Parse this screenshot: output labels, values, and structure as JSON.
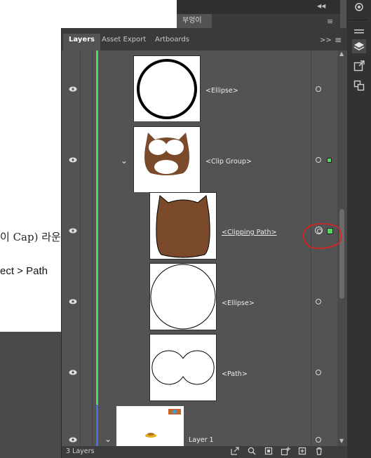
{
  "document": {
    "line1": "이 Cap) 라운",
    "line2": "ect > Path"
  },
  "mini_panel": {
    "tab": "부엉이",
    "collapse_icon": "double-chevron-right",
    "menu_icon": "hamburger"
  },
  "panel": {
    "tabs": [
      "Layers",
      "Asset Export",
      "Artboards"
    ],
    "active_tab": "Layers",
    "expand_icon": ">>",
    "footer_label": "3 Layers"
  },
  "layers": [
    {
      "name": "<Ellipse>",
      "visible": true,
      "target": "empty",
      "selected": false
    },
    {
      "name": "<Clip Group>",
      "visible": true,
      "expanded": true,
      "target": "empty",
      "selected": true
    },
    {
      "name": "<Clipping Path>",
      "visible": true,
      "target": "targeted",
      "selected": true,
      "underlined": true
    },
    {
      "name": "<Ellipse>",
      "visible": true,
      "target": "empty",
      "selected": false
    },
    {
      "name": "<Path>",
      "visible": true,
      "target": "empty",
      "selected": false
    },
    {
      "name": "Layer 1",
      "visible": true,
      "expanded": true,
      "target": "empty",
      "selected": false
    }
  ],
  "colors": {
    "layer_green": "#4ddc55",
    "layer_blue": "#4a6ee0",
    "annotation_red": "#e02020",
    "owl_brown": "#7a4a2a"
  },
  "footer_buttons": [
    "export-icon",
    "search-icon",
    "clip-mask-icon",
    "new-sublayer-icon",
    "new-layer-icon",
    "trash-icon"
  ],
  "toolbar_icons": [
    "layers-icon",
    "export-panel-icon",
    "artboard-icon"
  ]
}
